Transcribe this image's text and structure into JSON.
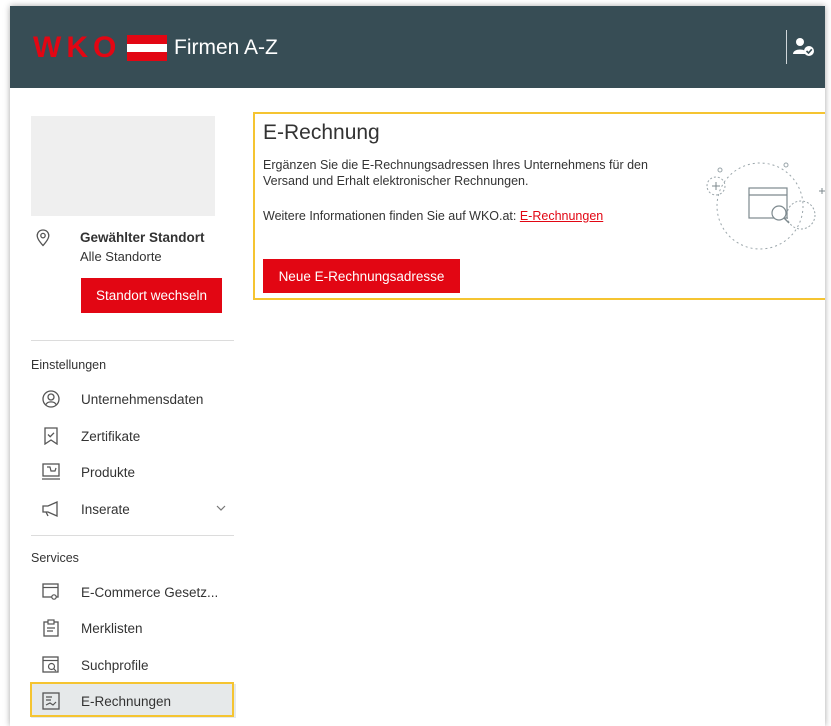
{
  "header": {
    "logo_text": "WKO",
    "app_title": "Firmen A-Z",
    "brand_red": "#e20613",
    "bar_color": "#374d55",
    "user_icon": "user-check-icon"
  },
  "sidebar": {
    "location": {
      "label": "Gewählter Standort",
      "value": "Alle Standorte",
      "change_button": "Standort wechseln",
      "icon": "location-pin-icon"
    },
    "sections": [
      {
        "title": "Einstellungen",
        "items": [
          {
            "label": "Unternehmensdaten",
            "icon": "user-circle-icon"
          },
          {
            "label": "Zertifikate",
            "icon": "certificate-icon"
          },
          {
            "label": "Produkte",
            "icon": "products-icon"
          },
          {
            "label": "Inserate",
            "icon": "megaphone-icon",
            "expandable": true
          }
        ]
      },
      {
        "title": "Services",
        "items": [
          {
            "label": "E-Commerce Gesetz...",
            "icon": "ecommerce-icon"
          },
          {
            "label": "Merklisten",
            "icon": "bookmark-list-icon"
          },
          {
            "label": "Suchprofile",
            "icon": "search-profile-icon"
          },
          {
            "label": "E-Rechnungen",
            "icon": "e-invoice-icon",
            "active": true
          }
        ]
      }
    ]
  },
  "main": {
    "title": "E-Rechnung",
    "description": "Ergänzen Sie die E-Rechnungsadressen Ihres Unternehmens für den Versand und Erhalt elektronischer Rechnungen.",
    "info_prefix": "Weitere Informationen finden Sie auf WKO.at: ",
    "info_link": "E-Rechnungen",
    "new_button": "Neue E-Rechnungsadresse",
    "highlight_color": "#f5c431"
  }
}
